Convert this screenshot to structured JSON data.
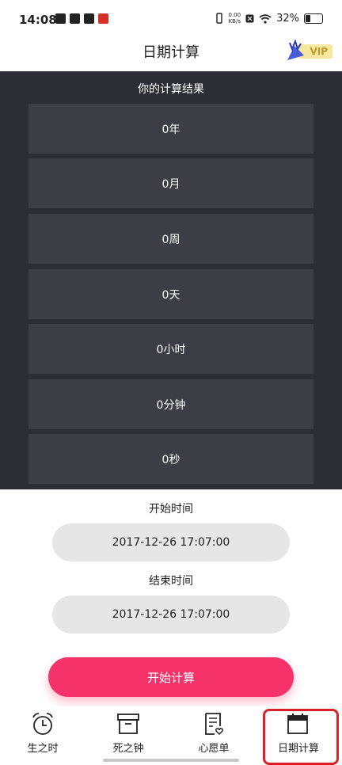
{
  "status_bar": {
    "time": "14:08",
    "net_speed_value": "0.00",
    "net_speed_unit": "KB/s",
    "battery": "32%",
    "battery_level": 0.32
  },
  "header": {
    "title": "日期计算",
    "vip_label": "VIP"
  },
  "results": {
    "title": "你的计算结果",
    "rows": [
      "0年",
      "0月",
      "0周",
      "0天",
      "0小时",
      "0分钟",
      "0秒"
    ]
  },
  "start": {
    "label": "开始时间",
    "value": "2017-12-26 17:07:00"
  },
  "end": {
    "label": "结束时间",
    "value": "2017-12-26 17:07:00"
  },
  "calculate_button": "开始计算",
  "bottom_nav": {
    "items": [
      {
        "label": "生之时",
        "icon": "alarm-clock-icon"
      },
      {
        "label": "死之钟",
        "icon": "archive-box-icon"
      },
      {
        "label": "心愿单",
        "icon": "wishlist-document-icon"
      },
      {
        "label": "日期计算",
        "icon": "calendar-icon"
      }
    ],
    "active_index": 3
  },
  "colors": {
    "panel_bg": "#2d2d35",
    "row_bg": "#3d3d46",
    "accent": "#f5336a",
    "highlight": "#d82129"
  }
}
